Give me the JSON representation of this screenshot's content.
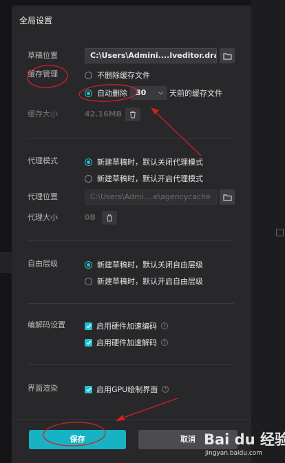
{
  "dialog": {
    "title": "全局设置"
  },
  "draft": {
    "label": "草稿位置",
    "path": "C:\\Users\\Admini....lveditor.draft"
  },
  "cache": {
    "label": "缓存管理",
    "option_keep": "不删除缓存文件",
    "option_auto": "自动删除",
    "days_value": "30",
    "days_suffix": "天前的缓存文件",
    "size_label": "缓存大小",
    "size_value": "42.16MB"
  },
  "proxy": {
    "mode_label": "代理模式",
    "option_off": "新建草稿时，默认关闭代理模式",
    "option_on": "新建草稿时，默认开启代理模式",
    "location_label": "代理位置",
    "location_path": "C:\\Users\\Admi....e\\agencycache",
    "size_label": "代理大小",
    "size_value": "0B"
  },
  "layer": {
    "label": "自由层级",
    "option_off": "新建草稿时，默认关闭自由层级",
    "option_on": "新建草稿时，默认开启自由层级"
  },
  "codec": {
    "label": "编解码设置",
    "encode": "启用硬件加速编码",
    "decode": "启用硬件加速解码"
  },
  "render": {
    "label": "界面渲染",
    "gpu": "启用GPU绘制界面"
  },
  "footer": {
    "save_label": "保存",
    "cancel_label": "取消"
  },
  "watermark": {
    "logo": "Bai du 经验",
    "url": "jingyan.baidu.com"
  },
  "colors": {
    "accent": "#21c1d6",
    "save_button": "#17b3c5",
    "annotation": "#d42020"
  }
}
